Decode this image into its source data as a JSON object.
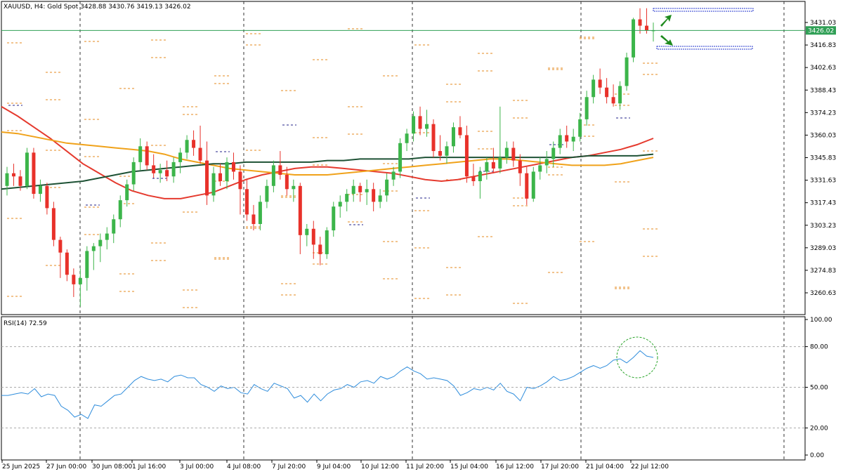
{
  "header": {
    "symbol_line": "XAUUSD, H4:  Gold Spot  3428.88 3430.76 3419.13 3426.02",
    "rsi_label": "RSI(14) 72.59"
  },
  "current_price": "3426.02",
  "colors": {
    "bull": "#3cb54a",
    "bear": "#e8312a",
    "ma_fast": "#e53a2e",
    "ma_mid": "#f0a21a",
    "ma_slow": "#1e5235",
    "rsi_line": "#2f8ddc",
    "level_orange": "#e58a1e",
    "level_navy": "#22228a",
    "price_tag": "#2f9f55"
  },
  "chart_data": [
    {
      "type": "candlestick",
      "title": "XAUUSD, H4",
      "y_ticks": [
        "3431.03",
        "3416.83",
        "3402.63",
        "3388.43",
        "3374.23",
        "3360.03",
        "3345.83",
        "3331.63",
        "3317.43",
        "3303.23",
        "3289.03",
        "3274.83",
        "3260.63"
      ],
      "x_ticks": [
        "25 Jun 2025",
        "27 Jun 00:00",
        "30 Jun 08:00",
        "1 Jul 16:00",
        "3 Jul 00:00",
        "4 Jul 08:00",
        "7 Jul 20:00",
        "9 Jul 04:00",
        "10 Jul 12:00",
        "11 Jul 20:00",
        "15 Jul 04:00",
        "16 Jul 12:00",
        "17 Jul 20:00",
        "21 Jul 04:00",
        "22 Jul 12:00"
      ],
      "ylim": [
        3250,
        3450
      ],
      "candles": [
        [
          3328,
          3340,
          3322,
          3336
        ],
        [
          3336,
          3342,
          3328,
          3334
        ],
        [
          3334,
          3338,
          3325,
          3328
        ],
        [
          3328,
          3352,
          3326,
          3349
        ],
        [
          3349,
          3352,
          3320,
          3323
        ],
        [
          3323,
          3332,
          3318,
          3328
        ],
        [
          3328,
          3330,
          3310,
          3314
        ],
        [
          3314,
          3318,
          3290,
          3294
        ],
        [
          3294,
          3296,
          3270,
          3286
        ],
        [
          3286,
          3288,
          3268,
          3272
        ],
        [
          3272,
          3276,
          3258,
          3266
        ],
        [
          3266,
          3276,
          3252,
          3270
        ],
        [
          3270,
          3290,
          3262,
          3287
        ],
        [
          3287,
          3292,
          3275,
          3290
        ],
        [
          3290,
          3298,
          3280,
          3294
        ],
        [
          3294,
          3302,
          3288,
          3298
        ],
        [
          3298,
          3310,
          3292,
          3307
        ],
        [
          3307,
          3322,
          3302,
          3319
        ],
        [
          3319,
          3332,
          3315,
          3329
        ],
        [
          3329,
          3346,
          3325,
          3343
        ],
        [
          3343,
          3358,
          3338,
          3353
        ],
        [
          3353,
          3356,
          3338,
          3341
        ],
        [
          3341,
          3348,
          3333,
          3336
        ],
        [
          3336,
          3342,
          3330,
          3338
        ],
        [
          3338,
          3344,
          3331,
          3334
        ],
        [
          3334,
          3346,
          3330,
          3343
        ],
        [
          3343,
          3352,
          3336,
          3349
        ],
        [
          3349,
          3360,
          3345,
          3357
        ],
        [
          3357,
          3363,
          3347,
          3352
        ],
        [
          3352,
          3366,
          3342,
          3344
        ],
        [
          3344,
          3356,
          3316,
          3322
        ],
        [
          3322,
          3340,
          3318,
          3336
        ],
        [
          3336,
          3342,
          3328,
          3331
        ],
        [
          3331,
          3346,
          3326,
          3343
        ],
        [
          3343,
          3349,
          3332,
          3337
        ],
        [
          3337,
          3341,
          3310,
          3326
        ],
        [
          3326,
          3332,
          3306,
          3310
        ],
        [
          3310,
          3316,
          3300,
          3304
        ],
        [
          3304,
          3322,
          3300,
          3318
        ],
        [
          3318,
          3332,
          3314,
          3328
        ],
        [
          3328,
          3344,
          3324,
          3341
        ],
        [
          3341,
          3350,
          3332,
          3335
        ],
        [
          3335,
          3340,
          3322,
          3326
        ],
        [
          3326,
          3332,
          3318,
          3328
        ],
        [
          3328,
          3330,
          3285,
          3297
        ],
        [
          3297,
          3304,
          3290,
          3301
        ],
        [
          3301,
          3306,
          3282,
          3291
        ],
        [
          3291,
          3296,
          3278,
          3285
        ],
        [
          3285,
          3302,
          3282,
          3300
        ],
        [
          3300,
          3318,
          3296,
          3315
        ],
        [
          3315,
          3322,
          3308,
          3318
        ],
        [
          3318,
          3326,
          3312,
          3323
        ],
        [
          3323,
          3332,
          3318,
          3328
        ],
        [
          3328,
          3330,
          3318,
          3324
        ],
        [
          3324,
          3332,
          3316,
          3326
        ],
        [
          3326,
          3330,
          3312,
          3318
        ],
        [
          3318,
          3326,
          3314,
          3322
        ],
        [
          3322,
          3336,
          3318,
          3332
        ],
        [
          3332,
          3340,
          3328,
          3337
        ],
        [
          3337,
          3358,
          3333,
          3355
        ],
        [
          3355,
          3364,
          3350,
          3361
        ],
        [
          3361,
          3375,
          3356,
          3372
        ],
        [
          3372,
          3378,
          3360,
          3364
        ],
        [
          3364,
          3376,
          3359,
          3367
        ],
        [
          3367,
          3370,
          3346,
          3350
        ],
        [
          3350,
          3360,
          3344,
          3347
        ],
        [
          3347,
          3356,
          3342,
          3353
        ],
        [
          3353,
          3368,
          3349,
          3365
        ],
        [
          3365,
          3372,
          3358,
          3360
        ],
        [
          3360,
          3366,
          3330,
          3334
        ],
        [
          3334,
          3342,
          3328,
          3331
        ],
        [
          3331,
          3340,
          3320,
          3337
        ],
        [
          3337,
          3346,
          3332,
          3343
        ],
        [
          3343,
          3352,
          3336,
          3339
        ],
        [
          3339,
          3378,
          3336,
          3346
        ],
        [
          3346,
          3356,
          3342,
          3352
        ],
        [
          3352,
          3356,
          3340,
          3344
        ],
        [
          3344,
          3348,
          3328,
          3336
        ],
        [
          3336,
          3340,
          3316,
          3320
        ],
        [
          3320,
          3340,
          3318,
          3337
        ],
        [
          3337,
          3346,
          3332,
          3341
        ],
        [
          3341,
          3350,
          3336,
          3345
        ],
        [
          3345,
          3356,
          3340,
          3352
        ],
        [
          3352,
          3364,
          3348,
          3360
        ],
        [
          3360,
          3366,
          3352,
          3356
        ],
        [
          3356,
          3364,
          3350,
          3359
        ],
        [
          3359,
          3374,
          3356,
          3370
        ],
        [
          3370,
          3388,
          3366,
          3384
        ],
        [
          3384,
          3398,
          3380,
          3395
        ],
        [
          3395,
          3402,
          3386,
          3390
        ],
        [
          3390,
          3396,
          3380,
          3384
        ],
        [
          3384,
          3392,
          3378,
          3380
        ],
        [
          3380,
          3394,
          3376,
          3391
        ],
        [
          3391,
          3412,
          3388,
          3409
        ],
        [
          3409,
          3434,
          3406,
          3433
        ],
        [
          3433,
          3440,
          3424,
          3429
        ],
        [
          3429,
          3440,
          3424,
          3426
        ],
        [
          3426,
          3431,
          3419,
          3426
        ]
      ],
      "moving_averages": [
        {
          "color_key": "ma_fast",
          "values": [
            3378,
            3372,
            3365,
            3358,
            3350,
            3342,
            3336,
            3330,
            3325,
            3322,
            3320,
            3320,
            3322,
            3324,
            3328,
            3332,
            3335,
            3337,
            3339,
            3340,
            3340,
            3339,
            3338,
            3337,
            3336,
            3334,
            3332,
            3331,
            3332,
            3334,
            3336,
            3338,
            3340,
            3342,
            3344,
            3346,
            3347,
            3349,
            3351,
            3354,
            3358
          ]
        },
        {
          "color_key": "ma_mid",
          "values": [
            3362,
            3361,
            3359,
            3357,
            3355,
            3354,
            3353,
            3352,
            3351,
            3350,
            3348,
            3345,
            3343,
            3341,
            3339,
            3338,
            3337,
            3336,
            3335,
            3335,
            3335,
            3336,
            3337,
            3338,
            3339,
            3340,
            3341,
            3342,
            3343,
            3344,
            3345,
            3345,
            3344,
            3343,
            3342,
            3341,
            3341,
            3341,
            3342,
            3344,
            3346
          ]
        },
        {
          "color_key": "ma_slow",
          "values": [
            3326,
            3327,
            3328,
            3329,
            3330,
            3331,
            3333,
            3335,
            3337,
            3338,
            3339,
            3340,
            3341,
            3342,
            3342,
            3343,
            3343,
            3343,
            3343,
            3343,
            3344,
            3344,
            3345,
            3345,
            3345,
            3345,
            3346,
            3346,
            3346,
            3346,
            3346,
            3346,
            3346,
            3346,
            3346,
            3346,
            3347,
            3347,
            3347,
            3347,
            3348
          ]
        }
      ]
    },
    {
      "type": "line",
      "title": "RSI(14) 72.59",
      "y_ticks": [
        "100.00",
        "80.00",
        "50.00",
        "20.00",
        "0.00"
      ],
      "ylim": [
        0,
        100
      ],
      "values": [
        44,
        44,
        45,
        46,
        45,
        49,
        43,
        45,
        44,
        36,
        33,
        28,
        30,
        27,
        37,
        36,
        40,
        44,
        45,
        50,
        55,
        58,
        56,
        55,
        56,
        54,
        58,
        59,
        57,
        57,
        52,
        50,
        47,
        51,
        49,
        50,
        46,
        45,
        52,
        49,
        47,
        53,
        51,
        49,
        42,
        44,
        39,
        45,
        40,
        45,
        48,
        49,
        52,
        50,
        54,
        55,
        53,
        58,
        56,
        58,
        62,
        65,
        62,
        60,
        56,
        57,
        56,
        55,
        51,
        44,
        46,
        49,
        48,
        50,
        48,
        53,
        47,
        45,
        40,
        50,
        49,
        51,
        54,
        58,
        55,
        56,
        58,
        61,
        64,
        66,
        64,
        66,
        70,
        71,
        68,
        72,
        77,
        73,
        72
      ]
    }
  ]
}
